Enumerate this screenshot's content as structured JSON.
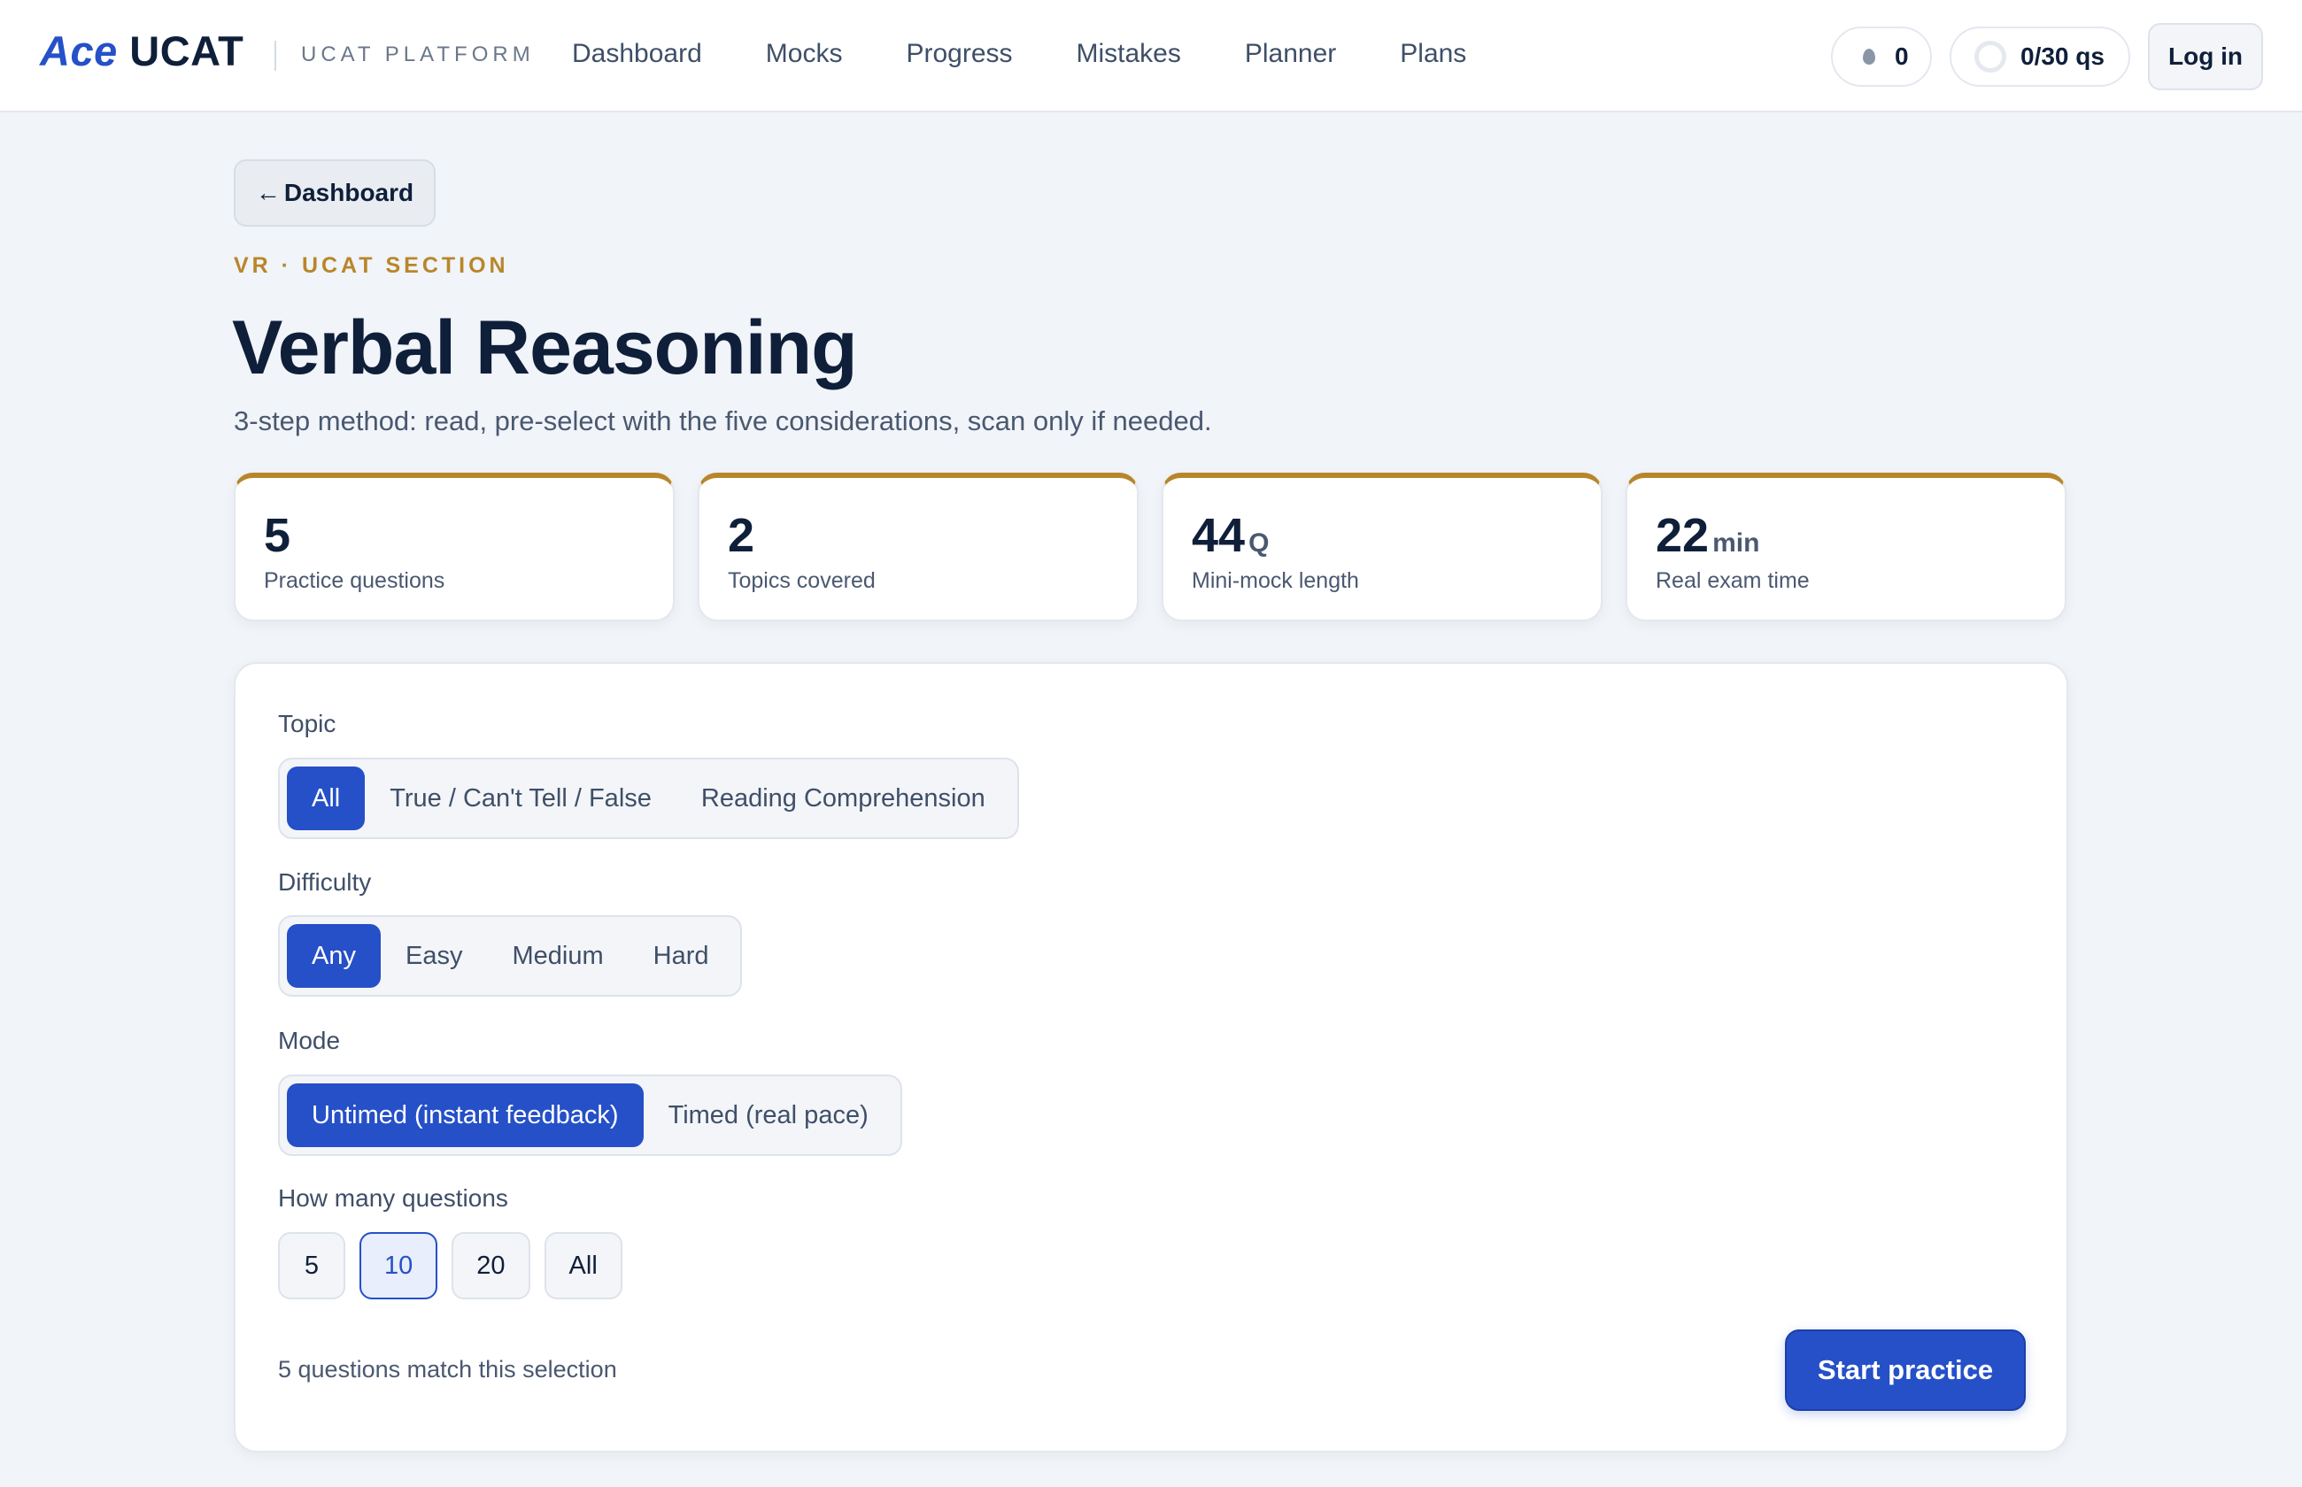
{
  "header": {
    "logo_ace": "Ace",
    "logo_ucat": "UCAT",
    "platform_label": "UCAT PLATFORM",
    "nav": [
      "Dashboard",
      "Mocks",
      "Progress",
      "Mistakes",
      "Planner",
      "Plans"
    ],
    "streak_count": "0",
    "questions_progress": "0/30 qs",
    "login_label": "Log in"
  },
  "back_label": "Dashboard",
  "eyebrow": "VR · UCAT SECTION",
  "title": "Verbal Reasoning",
  "subtitle": "3-step method: read, pre-select with the five considerations, scan only if needed.",
  "stats": [
    {
      "value": "5",
      "unit": "",
      "label": "Practice questions"
    },
    {
      "value": "2",
      "unit": "",
      "label": "Topics covered"
    },
    {
      "value": "44",
      "unit": "Q",
      "label": "Mini-mock length"
    },
    {
      "value": "22",
      "unit": "min",
      "label": "Real exam time"
    }
  ],
  "filters": {
    "topic_label": "Topic",
    "topic_options": [
      "All",
      "True / Can't Tell / False",
      "Reading Comprehension"
    ],
    "topic_selected": "All",
    "difficulty_label": "Difficulty",
    "difficulty_options": [
      "Any",
      "Easy",
      "Medium",
      "Hard"
    ],
    "difficulty_selected": "Any",
    "mode_label": "Mode",
    "mode_options": [
      "Untimed (instant feedback)",
      "Timed (real pace)"
    ],
    "mode_selected": "Untimed (instant feedback)",
    "count_label": "How many questions",
    "count_options": [
      "5",
      "10",
      "20",
      "All"
    ],
    "count_selected": "10"
  },
  "match_text": "5 questions match this selection",
  "start_label": "Start practice",
  "colors": {
    "accent": "#2550c8",
    "gold": "#b8862a",
    "text": "#0f1f3a"
  }
}
